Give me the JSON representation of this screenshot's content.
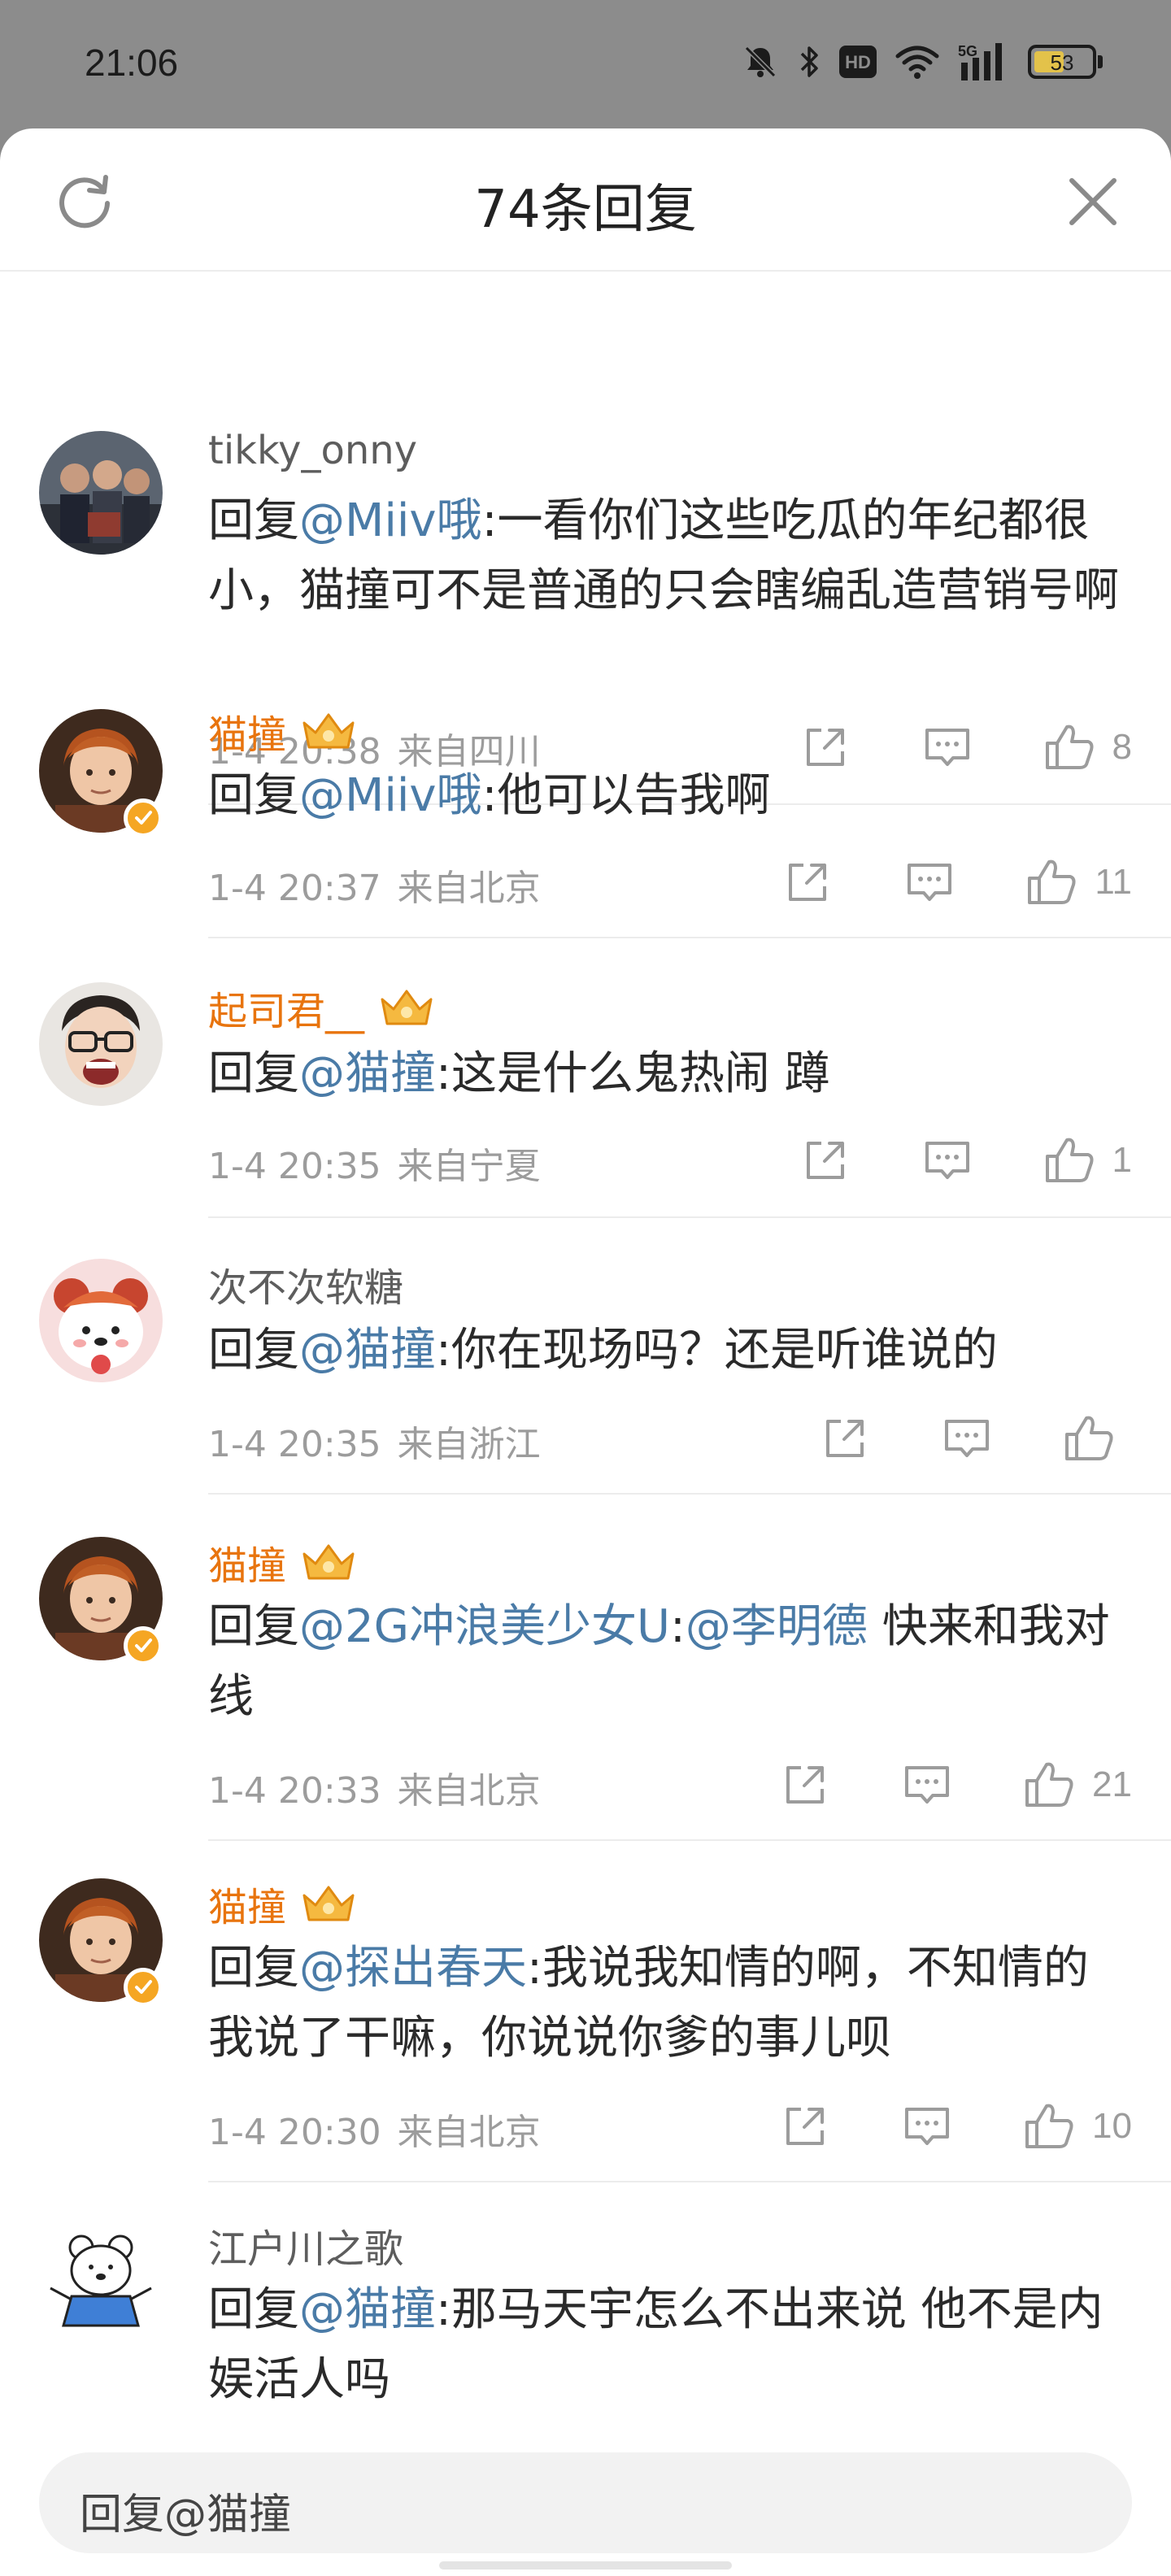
{
  "status_bar": {
    "time": "21:06",
    "network": "5G",
    "hd_label": "HD",
    "battery": "53",
    "battery_level": 0.53,
    "icons": [
      "mute-bell-icon",
      "bluetooth-icon",
      "hd-icon",
      "wifi-icon",
      "5g-signal-icon",
      "battery-icon"
    ]
  },
  "header": {
    "title": "74条回复",
    "refresh_icon": "refresh-icon",
    "close_icon": "close-icon"
  },
  "colors": {
    "mention": "#4a7ba7",
    "vip_name": "#e8740e",
    "verified_badge": "#f5a623",
    "meta": "#9c9c9c"
  },
  "comments": [
    {
      "username": "tikky_onny",
      "vip": false,
      "verified": false,
      "text": {
        "prefix": "回复",
        "mention": "@Miiv哦",
        "rest": ":一看你们这些吃瓜的年纪都很小，猫撞可不是普通的只会瞎编乱造营销号啊"
      },
      "time": "1-4 20:38",
      "location": "来自四川",
      "likes": "8"
    },
    {
      "username": "猫撞",
      "vip": true,
      "verified": true,
      "text": {
        "prefix": "回复",
        "mention": "@Miiv哦",
        "rest": ":他可以告我啊"
      },
      "time": "1-4 20:37",
      "location": "来自北京",
      "likes": "11"
    },
    {
      "username": "起司君__",
      "vip": true,
      "verified": false,
      "text": {
        "prefix": "回复",
        "mention": "@猫撞",
        "rest": ":这是什么鬼热闹 蹲"
      },
      "time": "1-4 20:35",
      "location": "来自宁夏",
      "likes": "1"
    },
    {
      "username": "次不次软糖",
      "vip": false,
      "verified": false,
      "text": {
        "prefix": "回复",
        "mention": "@猫撞",
        "rest": ":你在现场吗？还是听谁说的"
      },
      "time": "1-4 20:35",
      "location": "来自浙江",
      "likes": ""
    },
    {
      "username": "猫撞",
      "vip": true,
      "verified": true,
      "text": {
        "prefix": "回复",
        "mention": "@2G冲浪美少女U",
        "middle": ":",
        "mention2": "@李明德",
        "rest": " 快来和我对线"
      },
      "time": "1-4 20:33",
      "location": "来自北京",
      "likes": "21"
    },
    {
      "username": "猫撞",
      "vip": true,
      "verified": true,
      "text": {
        "prefix": "回复",
        "mention": "@探出春天",
        "rest": ":我说我知情的啊，不知情的我说了干嘛，你说说你爹的事儿呗"
      },
      "time": "1-4 20:30",
      "location": "来自北京",
      "likes": "10"
    },
    {
      "username": "江户川之歌",
      "vip": false,
      "verified": false,
      "text": {
        "prefix": "回复",
        "mention": "@猫撞",
        "rest": ":那马天宇怎么不出来说 他不是内娱活人吗"
      },
      "time": "",
      "location": "",
      "likes": ""
    }
  ],
  "reply_input": {
    "placeholder": "回复@猫撞"
  }
}
